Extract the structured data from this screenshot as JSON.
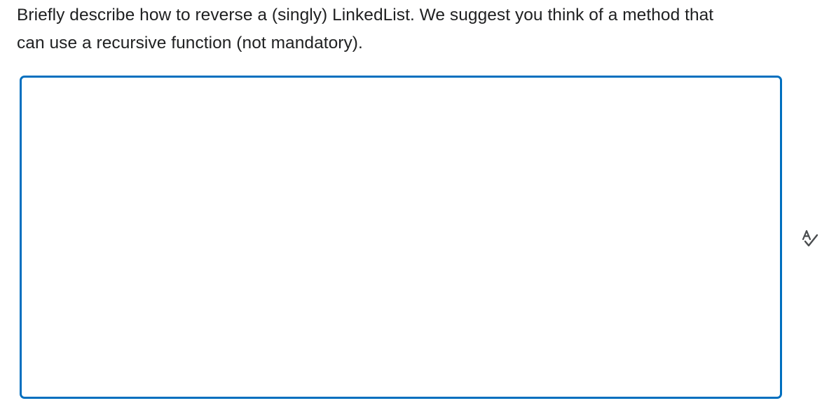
{
  "question": {
    "text": "Briefly describe how to reverse a (singly) LinkedList. We suggest you think of a method that can use a recursive function (not mandatory)."
  },
  "answer": {
    "value": "",
    "placeholder": ""
  },
  "icons": {
    "spellcheck": "spellcheck-icon"
  },
  "colors": {
    "accent": "#006fbf",
    "text": "#202122",
    "icon": "#494c4e"
  }
}
